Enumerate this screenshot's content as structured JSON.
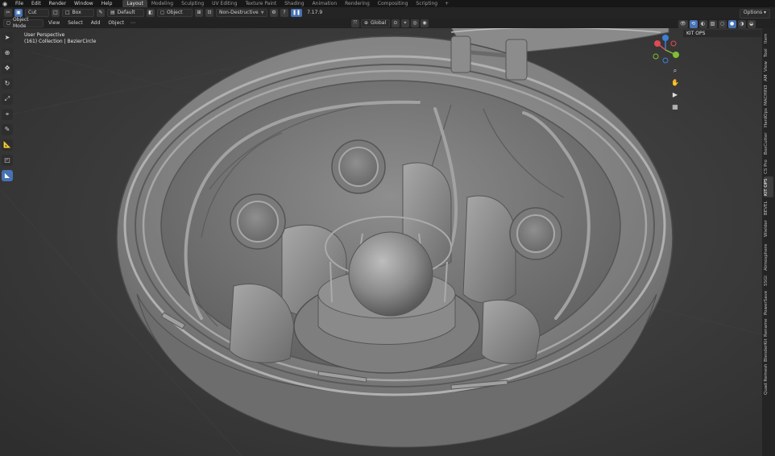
{
  "menu": {
    "items": [
      "File",
      "Edit",
      "Render",
      "Window",
      "Help"
    ]
  },
  "workspaces": {
    "tabs": [
      "Layout",
      "Modeling",
      "Sculpting",
      "UV Editing",
      "Texture Paint",
      "Shading",
      "Animation",
      "Rendering",
      "Compositing",
      "Scripting"
    ],
    "active": "Layout",
    "add_label": "+"
  },
  "tool_settings": {
    "operation": "Cut",
    "shape": "Box",
    "collection": "Default",
    "target": "Object",
    "mode": "Non-Destructive",
    "value": "7.17.9",
    "options_label": "Options"
  },
  "header": {
    "mode": "Object Mode",
    "menus": [
      "View",
      "Select",
      "Add",
      "Object"
    ],
    "orientation": "Global"
  },
  "viewport": {
    "perspective": "User Perspective",
    "collection_info": "(161) Collection | BezierCircle"
  },
  "npanel": {
    "title": "KIT OPS"
  },
  "sidebar_tabs": [
    "Item",
    "Tool",
    "View",
    "AM",
    "MACHIN3",
    "HardOps",
    "BoxCutter",
    "CS Pro",
    "KIT OPS",
    "BEVEL",
    "Wielder",
    "Atmosphere",
    "SSGI",
    "PowerSave",
    "Rename",
    "BlenderKit",
    "Quad Remesh"
  ],
  "active_sidebar_tab": "KIT OPS",
  "icons": {
    "gizmo": "navigation-gizmo",
    "zoom": "zoom-icon",
    "pan": "hand-icon",
    "camera": "camera-icon",
    "grid": "grid-icon"
  },
  "colors": {
    "accent": "#4772b3",
    "axis_x": "#e04a52",
    "axis_y": "#7fbf32",
    "axis_z": "#3f7fd6"
  }
}
